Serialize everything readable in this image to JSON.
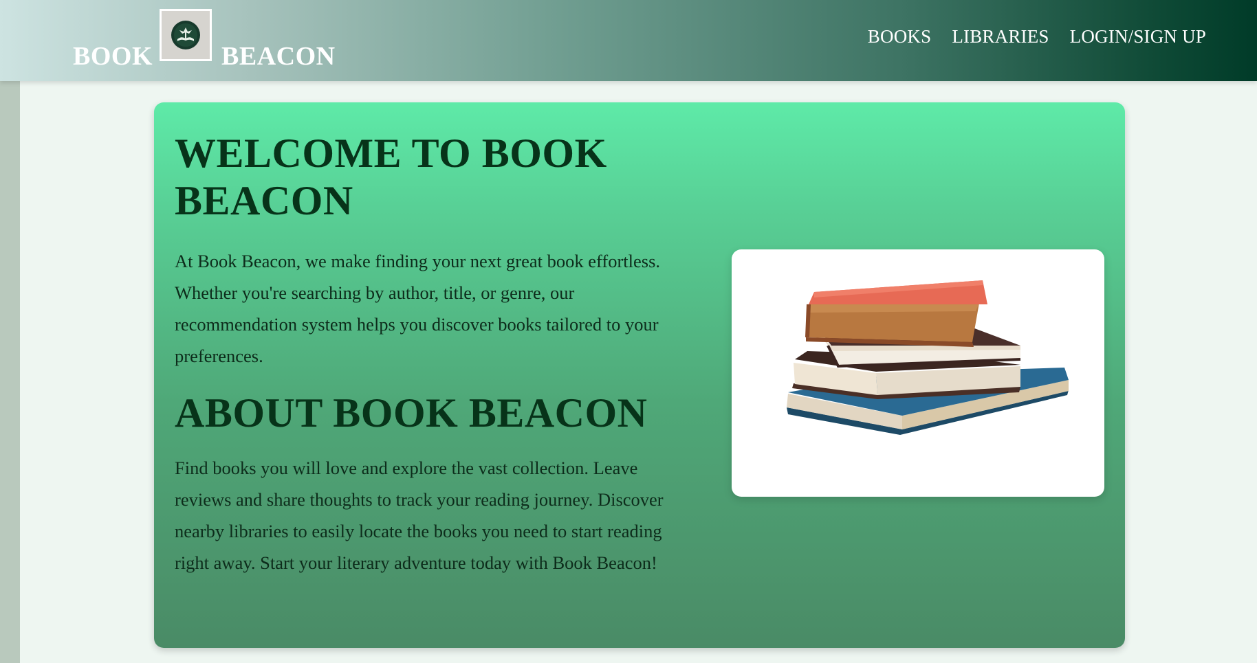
{
  "header": {
    "brand_left": "BOOK",
    "brand_right": "BEACON",
    "logo_icon": "book-lamp-logo-icon",
    "nav": [
      {
        "label": "BOOKS"
      },
      {
        "label": "LIBRARIES"
      },
      {
        "label": "LOGIN/SIGN UP"
      }
    ]
  },
  "hero": {
    "title": "WELCOME TO BOOK BEACON",
    "intro": "At Book Beacon, we make finding your next great book effortless. Whether you're searching by author, title, or genre, our recommendation system helps you discover books tailored to your preferences.",
    "about_title": "ABOUT BOOK BEACON",
    "about_text": "Find books you will love and explore the vast collection. Leave reviews and share thoughts to track your reading journey. Discover nearby libraries to easily locate the books you need to start reading right away. Start your literary adventure today with Book Beacon!",
    "image_icon": "stack-of-books-illustration"
  },
  "colors": {
    "header_start": "#cde3e1",
    "header_end": "#003b28",
    "hero_top": "#5eeaa8",
    "hero_bottom": "#4a8b66",
    "heading": "#073319",
    "page_bg": "#eef6f1"
  }
}
